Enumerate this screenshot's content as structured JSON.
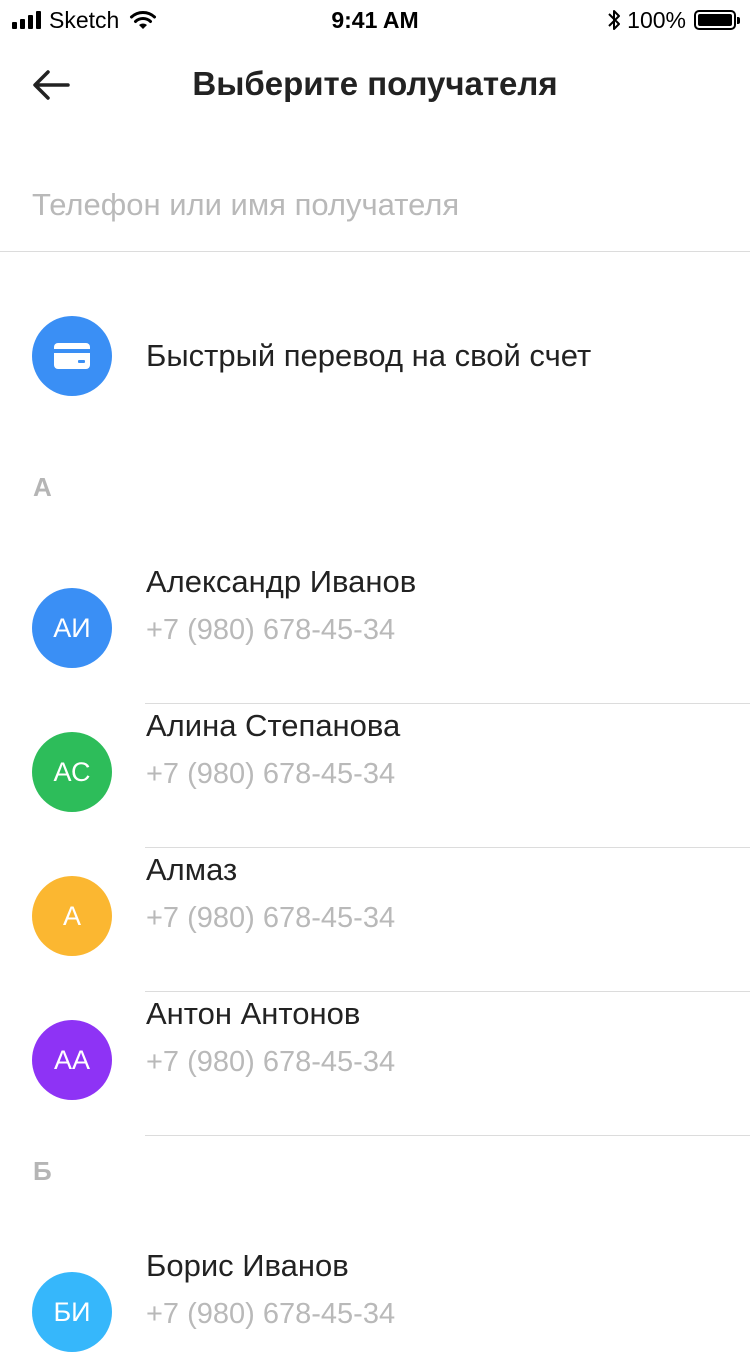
{
  "status_bar": {
    "carrier": "Sketch",
    "time": "9:41 AM",
    "battery_percent": "100%"
  },
  "header": {
    "title": "Выберите получателя"
  },
  "search": {
    "placeholder": "Телефон или имя получателя",
    "value": ""
  },
  "quick_transfer": {
    "label": "Быстрый перевод на свой счет",
    "icon": "card-icon",
    "color": "#3a8ff5"
  },
  "sections": [
    {
      "letter": "А",
      "contacts": [
        {
          "initials": "АИ",
          "name": "Александр Иванов",
          "phone": "+7 (980) 678-45-34",
          "color": "#3a8ff5"
        },
        {
          "initials": "АС",
          "name": "Алина Степанова",
          "phone": "+7 (980) 678-45-34",
          "color": "#2dbd5a"
        },
        {
          "initials": "А",
          "name": "Алмаз",
          "phone": "+7 (980) 678-45-34",
          "color": "#fbb731"
        },
        {
          "initials": "АА",
          "name": "Антон Антонов",
          "phone": "+7 (980) 678-45-34",
          "color": "#8e33f5"
        }
      ]
    },
    {
      "letter": "Б",
      "contacts": [
        {
          "initials": "БИ",
          "name": "Борис Иванов",
          "phone": "+7 (980) 678-45-34",
          "color": "#36b7fb"
        }
      ]
    }
  ]
}
